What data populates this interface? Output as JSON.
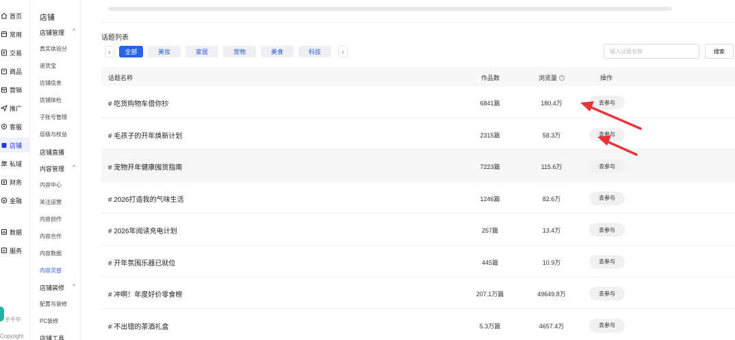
{
  "nav_primary": {
    "items": [
      {
        "label": "首页",
        "icon": "home-icon"
      },
      {
        "label": "常用",
        "icon": "bookmark-icon"
      },
      {
        "label": "交易",
        "icon": "document-icon"
      },
      {
        "label": "商品",
        "icon": "shopping-bag-icon"
      },
      {
        "label": "营销",
        "icon": "calendar-icon"
      },
      {
        "label": "推广",
        "icon": "send-icon"
      },
      {
        "label": "客服",
        "icon": "headset-icon"
      },
      {
        "label": "店铺",
        "icon": "store-icon",
        "active": true
      },
      {
        "label": "私域",
        "icon": "people-icon"
      },
      {
        "label": "财务",
        "icon": "wallet-icon"
      },
      {
        "label": "金融",
        "icon": "finance-icon"
      },
      {
        "label": "数据",
        "icon": "chart-icon"
      },
      {
        "label": "服务",
        "icon": "service-icon"
      }
    ],
    "footer_brand": "于千牛",
    "footer_copyright": "Copyright"
  },
  "nav_secondary": {
    "title": "店铺",
    "groups": [
      {
        "label": "店铺管理",
        "caret": "^"
      },
      {
        "label": "内容管理",
        "caret": "^"
      },
      {
        "label": "店铺装修",
        "caret": "^"
      }
    ],
    "items": [
      {
        "label": "真实体验分"
      },
      {
        "label": "退货宝"
      },
      {
        "label": "店铺信息"
      },
      {
        "label": "店铺体检"
      },
      {
        "label": "子账号管理"
      },
      {
        "label": "层级与权益"
      },
      {
        "label": "店铺直播"
      },
      {
        "label": "内容中心"
      },
      {
        "label": "关注运营"
      },
      {
        "label": "内容创作"
      },
      {
        "label": "内容合作"
      },
      {
        "label": "内容数据"
      },
      {
        "label": "内容灵感"
      },
      {
        "label": "配置与装修"
      },
      {
        "label": "PC装修"
      },
      {
        "label": "店铺工具"
      }
    ]
  },
  "main": {
    "section_title": "话题列表",
    "prev_arrow": "‹",
    "next_arrow": "›",
    "categories": [
      "全部",
      "美妆",
      "家居",
      "宠物",
      "美食",
      "科技"
    ],
    "search": {
      "placeholder": "输入话题名称",
      "button_label": "搜索"
    },
    "table": {
      "headers": {
        "name": "话题名称",
        "works": "作品数",
        "views": "浏览量",
        "action": "操作"
      },
      "help_glyph": "?",
      "rows": [
        {
          "name": "# 吃货购物车借你抄",
          "works": "6841篇",
          "views": "180.4万",
          "action": "去参与"
        },
        {
          "name": "# 毛孩子的开年焕新计划",
          "works": "2315篇",
          "views": "58.3万",
          "action": "去参与"
        },
        {
          "name": "# 宠物开年健康囤货指南",
          "works": "7223篇",
          "views": "115.6万",
          "action": "去参与"
        },
        {
          "name": "# 2026打造我的气味生活",
          "works": "1246篇",
          "views": "82.6万",
          "action": "去参与"
        },
        {
          "name": "# 2026年阅读充电计划",
          "works": "257篇",
          "views": "13.4万",
          "action": "去参与"
        },
        {
          "name": "# 开年氛围乐器已就位",
          "works": "445篇",
          "views": "10.9万",
          "action": "去参与"
        },
        {
          "name": "# 冲啊！年度好价零食榜",
          "works": "207.1万篇",
          "views": "49649.8万",
          "action": "去参与"
        },
        {
          "name": "# 不出错的茶酒礼盒",
          "works": "5.3万篇",
          "views": "4657.4万",
          "action": "去参与"
        }
      ]
    }
  },
  "colors": {
    "accent": "#2563eb",
    "annotation_arrow": "#e8323c"
  }
}
